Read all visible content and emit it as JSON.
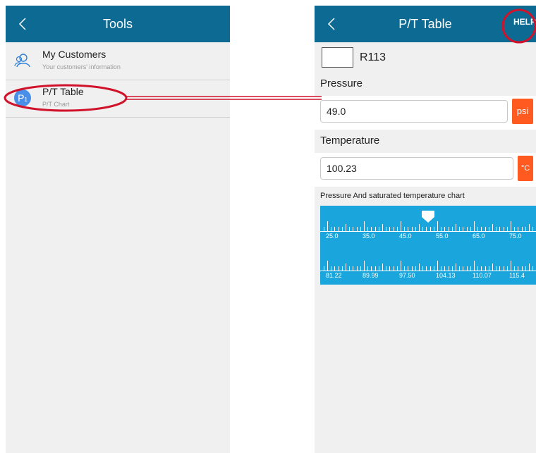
{
  "left_screen": {
    "header": {
      "title": "Tools"
    },
    "items": [
      {
        "name": "My Customers",
        "subtitle": "Your customers' information",
        "icon": "users-icon"
      },
      {
        "name": "P/T Table",
        "subtitle": "P/T Chart",
        "icon": "pt-table-icon",
        "icon_text": "P",
        "icon_sub": "1"
      }
    ]
  },
  "right_screen": {
    "header": {
      "title": "P/T Table",
      "help_label": "HELP"
    },
    "refrigerant": "R113",
    "pressure": {
      "label": "Pressure",
      "value": "49.0",
      "unit": "psi"
    },
    "temperature": {
      "label": "Temperature",
      "value": "100.23",
      "unit": "°C"
    },
    "chart": {
      "title": "Pressure And saturated temperature chart",
      "pressure_labels": [
        "25.0",
        "35.0",
        "45.0",
        "55.0",
        "65.0",
        "75.0"
      ],
      "temperature_labels": [
        "81.22",
        "89.99",
        "97.50",
        "104.13",
        "110.07",
        "115.4"
      ]
    }
  },
  "colors": {
    "header": "#0d6a93",
    "accent_orange": "#ff5a1f",
    "chart_bg": "#1aa6dc",
    "highlight_red": "#d0122a"
  }
}
